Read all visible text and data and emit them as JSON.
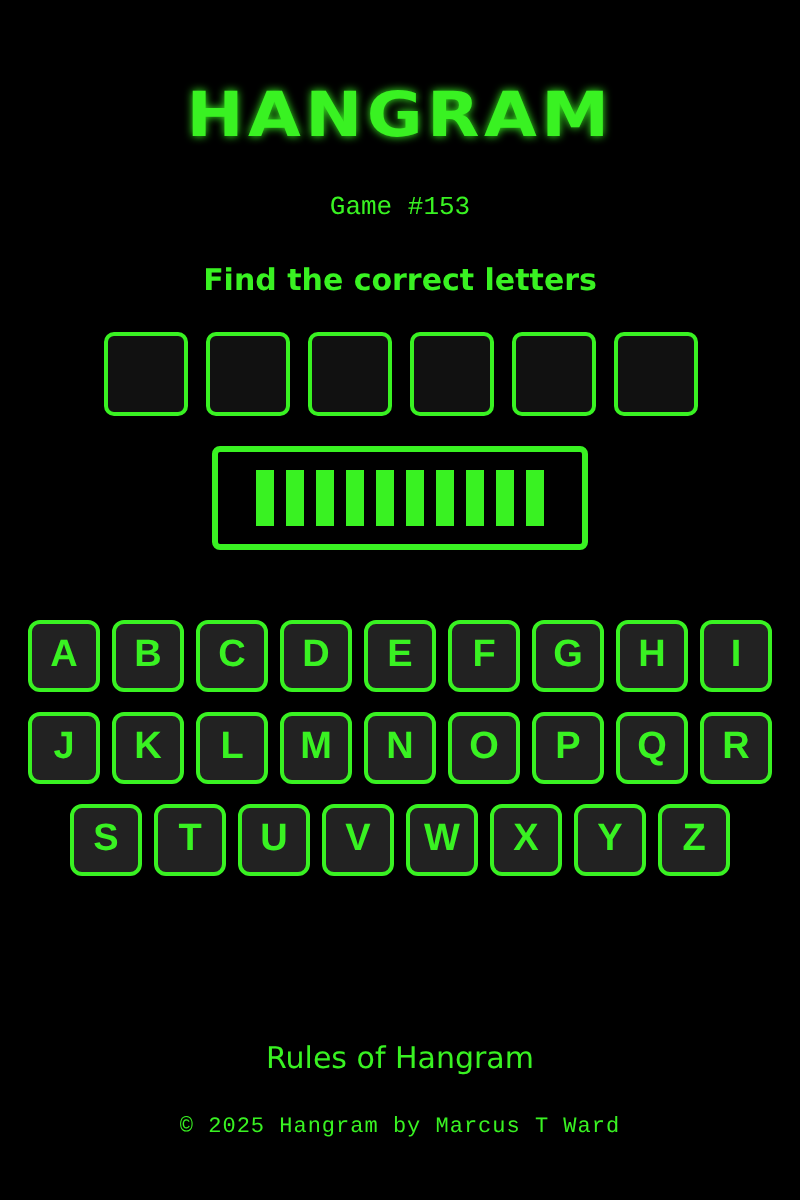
{
  "title": "HANGRAM",
  "game": "Game #153",
  "prompt": "Find the correct letters",
  "slots": [
    {
      "filled": false
    },
    {
      "filled": false
    },
    {
      "filled": false
    },
    {
      "filled": false
    },
    {
      "filled": false
    },
    {
      "filled": false
    }
  ],
  "lives": {
    "level": 1
  },
  "keyboard_rows": [
    [
      "A",
      "B",
      "C",
      "D",
      "E",
      "F",
      "G",
      "H",
      "I"
    ],
    [
      "J",
      "K",
      "L",
      "M",
      "N",
      "O",
      "P",
      "Q",
      "R"
    ],
    [
      "S",
      "T",
      "U",
      "V",
      "W",
      "X",
      "Y",
      "Z"
    ]
  ],
  "rules_link": "Rules of Hangram",
  "footer": "© 2025 Hangram by Marcus T Ward"
}
